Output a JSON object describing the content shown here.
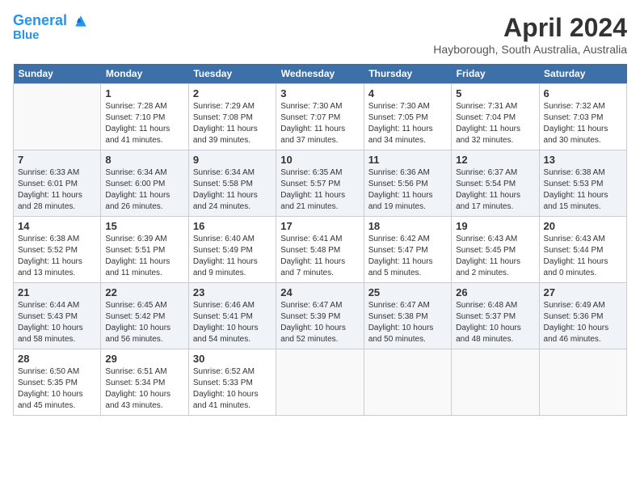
{
  "header": {
    "logo_line1": "General",
    "logo_line2": "Blue",
    "month": "April 2024",
    "location": "Hayborough, South Australia, Australia"
  },
  "weekdays": [
    "Sunday",
    "Monday",
    "Tuesday",
    "Wednesday",
    "Thursday",
    "Friday",
    "Saturday"
  ],
  "weeks": [
    [
      {
        "day": "",
        "info": ""
      },
      {
        "day": "1",
        "info": "Sunrise: 7:28 AM\nSunset: 7:10 PM\nDaylight: 11 hours\nand 41 minutes."
      },
      {
        "day": "2",
        "info": "Sunrise: 7:29 AM\nSunset: 7:08 PM\nDaylight: 11 hours\nand 39 minutes."
      },
      {
        "day": "3",
        "info": "Sunrise: 7:30 AM\nSunset: 7:07 PM\nDaylight: 11 hours\nand 37 minutes."
      },
      {
        "day": "4",
        "info": "Sunrise: 7:30 AM\nSunset: 7:05 PM\nDaylight: 11 hours\nand 34 minutes."
      },
      {
        "day": "5",
        "info": "Sunrise: 7:31 AM\nSunset: 7:04 PM\nDaylight: 11 hours\nand 32 minutes."
      },
      {
        "day": "6",
        "info": "Sunrise: 7:32 AM\nSunset: 7:03 PM\nDaylight: 11 hours\nand 30 minutes."
      }
    ],
    [
      {
        "day": "7",
        "info": "Sunrise: 6:33 AM\nSunset: 6:01 PM\nDaylight: 11 hours\nand 28 minutes."
      },
      {
        "day": "8",
        "info": "Sunrise: 6:34 AM\nSunset: 6:00 PM\nDaylight: 11 hours\nand 26 minutes."
      },
      {
        "day": "9",
        "info": "Sunrise: 6:34 AM\nSunset: 5:58 PM\nDaylight: 11 hours\nand 24 minutes."
      },
      {
        "day": "10",
        "info": "Sunrise: 6:35 AM\nSunset: 5:57 PM\nDaylight: 11 hours\nand 21 minutes."
      },
      {
        "day": "11",
        "info": "Sunrise: 6:36 AM\nSunset: 5:56 PM\nDaylight: 11 hours\nand 19 minutes."
      },
      {
        "day": "12",
        "info": "Sunrise: 6:37 AM\nSunset: 5:54 PM\nDaylight: 11 hours\nand 17 minutes."
      },
      {
        "day": "13",
        "info": "Sunrise: 6:38 AM\nSunset: 5:53 PM\nDaylight: 11 hours\nand 15 minutes."
      }
    ],
    [
      {
        "day": "14",
        "info": "Sunrise: 6:38 AM\nSunset: 5:52 PM\nDaylight: 11 hours\nand 13 minutes."
      },
      {
        "day": "15",
        "info": "Sunrise: 6:39 AM\nSunset: 5:51 PM\nDaylight: 11 hours\nand 11 minutes."
      },
      {
        "day": "16",
        "info": "Sunrise: 6:40 AM\nSunset: 5:49 PM\nDaylight: 11 hours\nand 9 minutes."
      },
      {
        "day": "17",
        "info": "Sunrise: 6:41 AM\nSunset: 5:48 PM\nDaylight: 11 hours\nand 7 minutes."
      },
      {
        "day": "18",
        "info": "Sunrise: 6:42 AM\nSunset: 5:47 PM\nDaylight: 11 hours\nand 5 minutes."
      },
      {
        "day": "19",
        "info": "Sunrise: 6:43 AM\nSunset: 5:45 PM\nDaylight: 11 hours\nand 2 minutes."
      },
      {
        "day": "20",
        "info": "Sunrise: 6:43 AM\nSunset: 5:44 PM\nDaylight: 11 hours\nand 0 minutes."
      }
    ],
    [
      {
        "day": "21",
        "info": "Sunrise: 6:44 AM\nSunset: 5:43 PM\nDaylight: 10 hours\nand 58 minutes."
      },
      {
        "day": "22",
        "info": "Sunrise: 6:45 AM\nSunset: 5:42 PM\nDaylight: 10 hours\nand 56 minutes."
      },
      {
        "day": "23",
        "info": "Sunrise: 6:46 AM\nSunset: 5:41 PM\nDaylight: 10 hours\nand 54 minutes."
      },
      {
        "day": "24",
        "info": "Sunrise: 6:47 AM\nSunset: 5:39 PM\nDaylight: 10 hours\nand 52 minutes."
      },
      {
        "day": "25",
        "info": "Sunrise: 6:47 AM\nSunset: 5:38 PM\nDaylight: 10 hours\nand 50 minutes."
      },
      {
        "day": "26",
        "info": "Sunrise: 6:48 AM\nSunset: 5:37 PM\nDaylight: 10 hours\nand 48 minutes."
      },
      {
        "day": "27",
        "info": "Sunrise: 6:49 AM\nSunset: 5:36 PM\nDaylight: 10 hours\nand 46 minutes."
      }
    ],
    [
      {
        "day": "28",
        "info": "Sunrise: 6:50 AM\nSunset: 5:35 PM\nDaylight: 10 hours\nand 45 minutes."
      },
      {
        "day": "29",
        "info": "Sunrise: 6:51 AM\nSunset: 5:34 PM\nDaylight: 10 hours\nand 43 minutes."
      },
      {
        "day": "30",
        "info": "Sunrise: 6:52 AM\nSunset: 5:33 PM\nDaylight: 10 hours\nand 41 minutes."
      },
      {
        "day": "",
        "info": ""
      },
      {
        "day": "",
        "info": ""
      },
      {
        "day": "",
        "info": ""
      },
      {
        "day": "",
        "info": ""
      }
    ]
  ]
}
